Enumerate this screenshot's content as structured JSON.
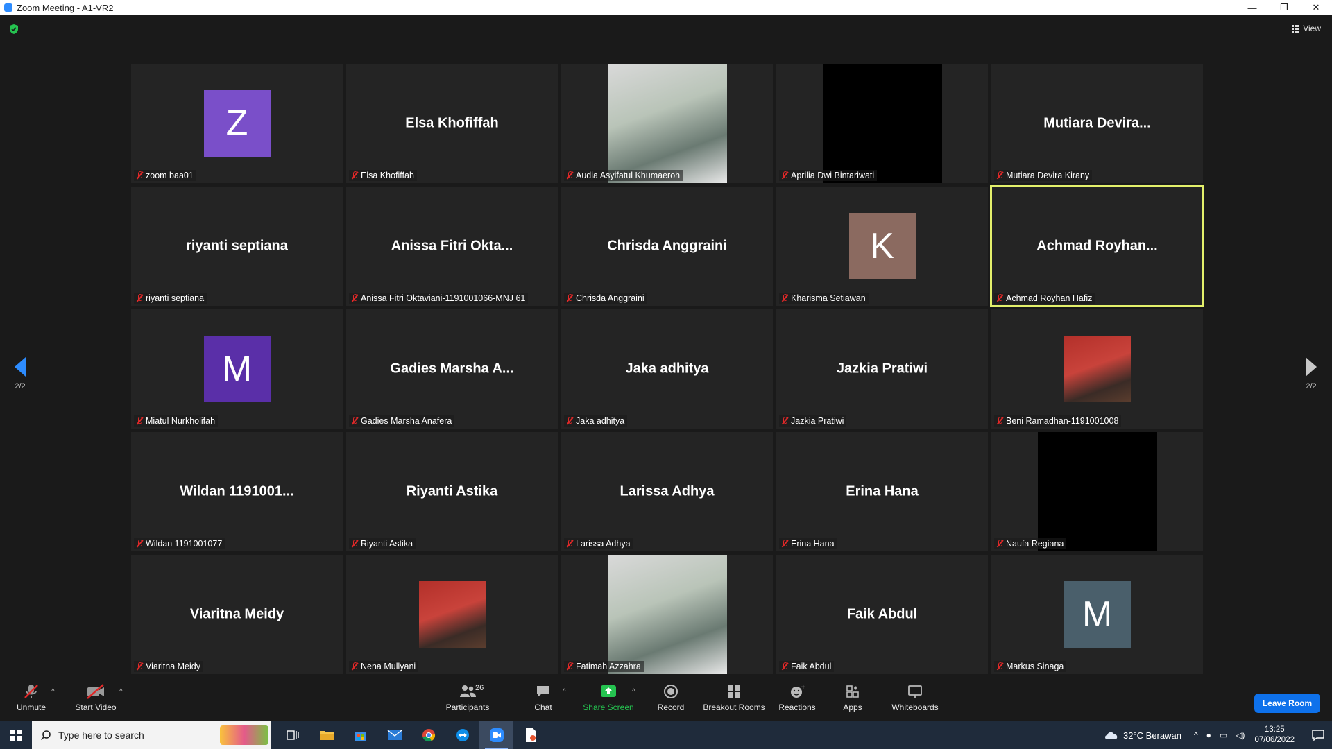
{
  "window": {
    "title": "Zoom Meeting - A1-VR2",
    "minimize": "—",
    "maximize": "❐",
    "close": "✕"
  },
  "view_label": "View",
  "nav": {
    "page": "2/2"
  },
  "tiles": [
    {
      "type": "avatar",
      "letter": "Z",
      "color": "#7a4fc9",
      "label": "zoom baa01"
    },
    {
      "type": "name",
      "display": "Elsa Khofiffah",
      "label": "Elsa Khofiffah"
    },
    {
      "type": "photo",
      "label": "Audia Asyifatul Khumaeroh"
    },
    {
      "type": "black",
      "label": "Aprilia Dwi Bintariwati"
    },
    {
      "type": "name",
      "display": "Mutiara  Devira...",
      "label": "Mutiara Devira Kirany"
    },
    {
      "type": "name",
      "display": "riyanti septiana",
      "label": "riyanti septiana"
    },
    {
      "type": "name",
      "display": "Anissa  Fitri  Okta...",
      "label": "Anissa Fitri Oktaviani-1191001066-MNJ 61"
    },
    {
      "type": "name",
      "display": "Chrisda Anggraini",
      "label": "Chrisda Anggraini"
    },
    {
      "type": "avatar",
      "letter": "K",
      "color": "#8b6a60",
      "label": "Kharisma Setiawan"
    },
    {
      "type": "name",
      "display": "Achmad  Royhan...",
      "label": "Achmad Royhan Hafiz",
      "active": true
    },
    {
      "type": "avatar",
      "letter": "M",
      "color": "#5a2fa8",
      "label": "Miatul Nurkholifah"
    },
    {
      "type": "name",
      "display": "Gadies  Marsha  A...",
      "label": "Gadies Marsha Anafera"
    },
    {
      "type": "name",
      "display": "Jaka adhitya",
      "label": "Jaka adhitya"
    },
    {
      "type": "name",
      "display": "Jazkia Pratiwi",
      "label": "Jazkia Pratiwi"
    },
    {
      "type": "photo-small",
      "label": "Beni Ramadhan-1191001008"
    },
    {
      "type": "name",
      "display": "Wildan  1191001...",
      "label": "Wildan 1191001077"
    },
    {
      "type": "name",
      "display": "Riyanti Astika",
      "label": "Riyanti Astika"
    },
    {
      "type": "name",
      "display": "Larissa Adhya",
      "label": "Larissa Adhya"
    },
    {
      "type": "name",
      "display": "Erina Hana",
      "label": "Erina Hana"
    },
    {
      "type": "black",
      "label": "Naufa Regiana"
    },
    {
      "type": "name",
      "display": "Viaritna Meidy",
      "label": "Viaritna Meidy"
    },
    {
      "type": "photo-small",
      "label": "Nena Mullyani"
    },
    {
      "type": "photo",
      "label": "Fatimah Azzahra"
    },
    {
      "type": "name",
      "display": "Faik Abdul",
      "label": "Faik Abdul"
    },
    {
      "type": "avatar",
      "letter": "M",
      "color": "#4a5f6b",
      "label": "Markus Sinaga"
    }
  ],
  "toolbar": {
    "unmute": "Unmute",
    "start_video": "Start Video",
    "participants": "Participants",
    "participants_count": "26",
    "chat": "Chat",
    "share_screen": "Share Screen",
    "record": "Record",
    "breakout_rooms": "Breakout Rooms",
    "reactions": "Reactions",
    "apps": "Apps",
    "whiteboards": "Whiteboards",
    "leave_room": "Leave Room"
  },
  "taskbar": {
    "search_placeholder": "Type here to search",
    "weather": "32°C  Berawan",
    "time": "13:25",
    "date": "07/06/2022"
  }
}
